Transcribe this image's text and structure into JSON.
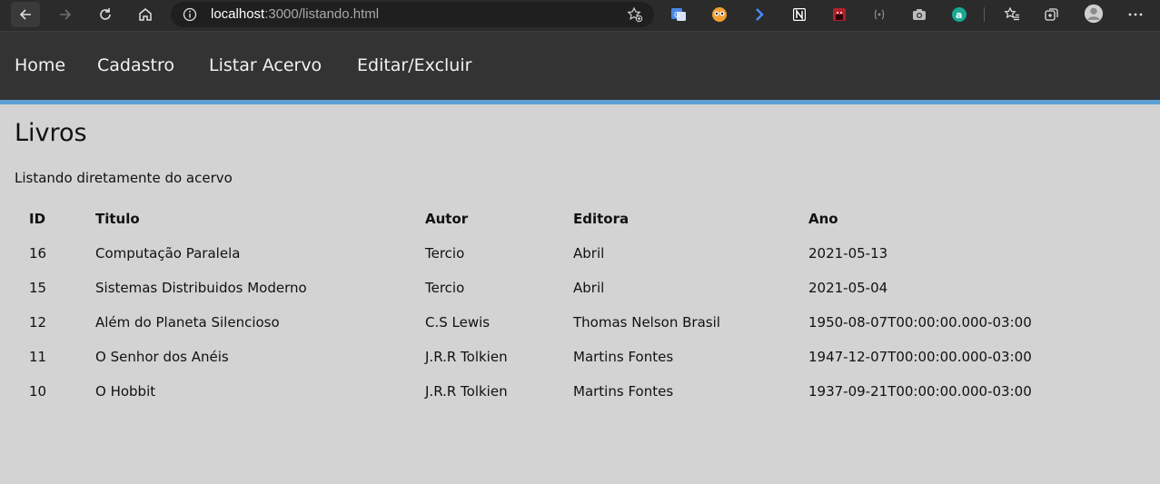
{
  "browser": {
    "address": {
      "host": "localhost",
      "rest": ":3000/listando.html"
    },
    "colors": {
      "chrome": "#2b2b2b",
      "address_bg": "#1f1f1f"
    }
  },
  "nav": {
    "links": [
      "Home",
      "Cadastro",
      "Listar Acervo",
      "Editar/Excluir"
    ],
    "colors": {
      "background": "#333333",
      "accent": "#5aa0d4"
    }
  },
  "page": {
    "title": "Livros",
    "subtitle": "Listando diretamente do acervo",
    "background": "#d3d3d3"
  },
  "table": {
    "headers": [
      "ID",
      "Titulo",
      "Autor",
      "Editora",
      "Ano"
    ],
    "rows": [
      [
        "16",
        "Computação Paralela",
        "Tercio",
        "Abril",
        "2021-05-13"
      ],
      [
        "15",
        "Sistemas Distribuidos Moderno",
        "Tercio",
        "Abril",
        "2021-05-04"
      ],
      [
        "12",
        "Além do Planeta Silencioso",
        "C.S Lewis",
        "Thomas Nelson Brasil",
        "1950-08-07T00:00:00.000-03:00"
      ],
      [
        "11",
        "O Senhor dos Anéis",
        "J.R.R Tolkien",
        "Martins Fontes",
        "1947-12-07T00:00:00.000-03:00"
      ],
      [
        "10",
        "O Hobbit",
        "J.R.R Tolkien",
        "Martins Fontes",
        "1937-09-21T00:00:00.000-03:00"
      ]
    ]
  }
}
